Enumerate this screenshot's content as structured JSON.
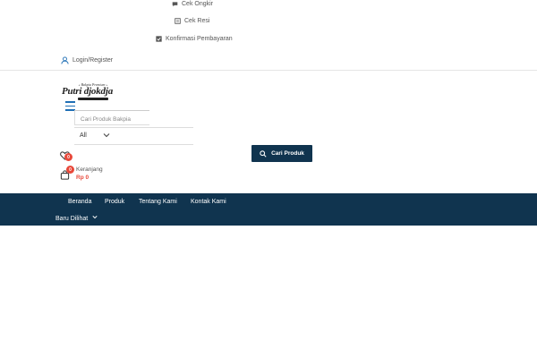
{
  "topbar": {
    "shipping_label": "Cek Ongkir",
    "receipt_label": "Cek Resi",
    "payment_label": "Konfirmasi Pembayaran",
    "login_label": "Login/Register"
  },
  "logo": {
    "tagline": "« Bakpia Premium »",
    "name": "Putri djokdja"
  },
  "search": {
    "placeholder": "Cari Produk Bakpia",
    "category_value": "All",
    "button_label": "Cari Produk"
  },
  "wishlist": {
    "count": "0"
  },
  "cart": {
    "count": "0",
    "label": "Keranjang",
    "total": "Rp 0"
  },
  "nav": {
    "items": [
      {
        "label": "Beranda"
      },
      {
        "label": "Produk"
      },
      {
        "label": "Tentang Kami"
      },
      {
        "label": "Kontak Kami"
      }
    ],
    "recent_label": "Baru Dilihat"
  },
  "colors": {
    "navbar": "#10344f",
    "accent_red": "#e8483a",
    "icon_blue": "#1f6fb5"
  }
}
